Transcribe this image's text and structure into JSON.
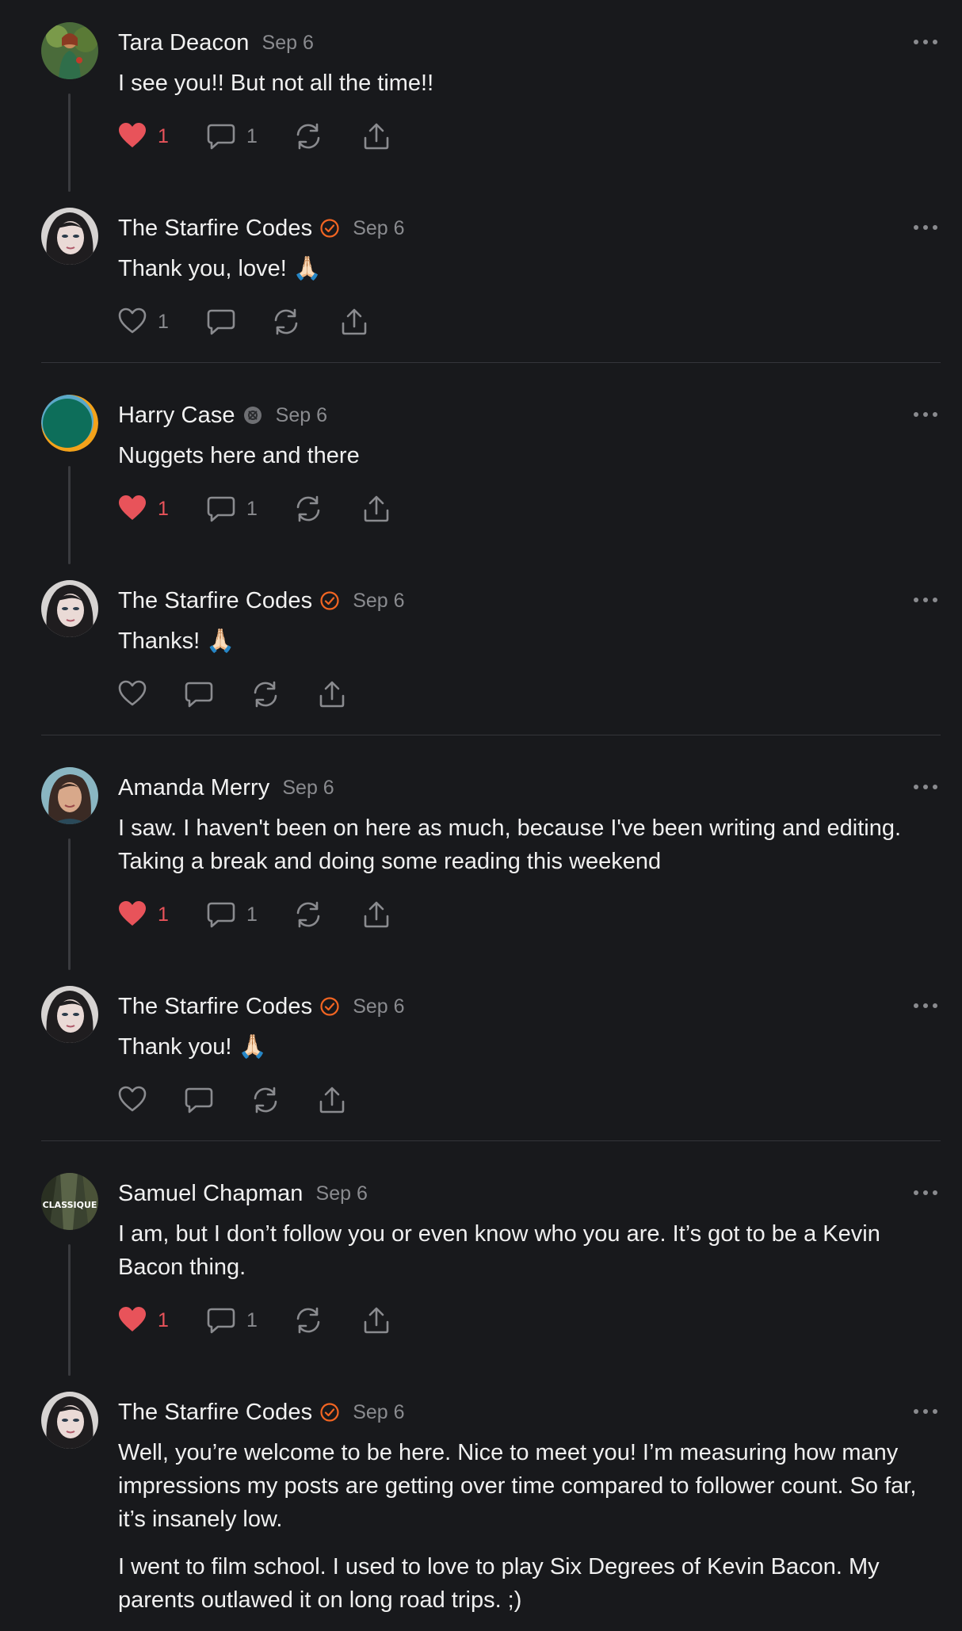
{
  "posts": [
    {
      "author": "Tara Deacon",
      "date": "Sep 6",
      "verified": false,
      "body": [
        "I see you!! But not all the time!!"
      ],
      "likes": "1",
      "replies": "1",
      "liked": true
    },
    {
      "author": "The Starfire Codes",
      "date": "Sep 6",
      "verified": true,
      "body": [
        "Thank you, love! 🙏🏻"
      ],
      "likes": "1",
      "replies": "",
      "liked": false
    },
    {
      "author": "Harry Case",
      "date": "Sep 6",
      "verified": false,
      "body": [
        "Nuggets here and there"
      ],
      "likes": "1",
      "replies": "1",
      "liked": true
    },
    {
      "author": "The Starfire Codes",
      "date": "Sep 6",
      "verified": true,
      "body": [
        "Thanks! 🙏🏻"
      ],
      "likes": "",
      "replies": "",
      "liked": false
    },
    {
      "author": "Amanda Merry",
      "date": "Sep 6",
      "verified": false,
      "body": [
        "I saw. I haven't been on here as much, because I've been writing and editing. Taking a break and doing some reading this weekend"
      ],
      "likes": "1",
      "replies": "1",
      "liked": true
    },
    {
      "author": "The Starfire Codes",
      "date": "Sep 6",
      "verified": true,
      "body": [
        "Thank you! 🙏🏻"
      ],
      "likes": "",
      "replies": "",
      "liked": false
    },
    {
      "author": "Samuel Chapman",
      "date": "Sep 6",
      "verified": false,
      "body": [
        "I am, but I don’t follow you or even know who you are. It’s got to be a Kevin Bacon thing."
      ],
      "likes": "1",
      "replies": "1",
      "liked": true
    },
    {
      "author": "The Starfire Codes",
      "date": "Sep 6",
      "verified": true,
      "body": [
        "Well, you’re welcome to be here. Nice to meet you! I’m measuring how many impressions my posts are getting over time compared to follower count. So far, it’s insanely low.",
        "I went to film school. I used to love to play Six Degrees of Kevin Bacon. My parents outlawed it on long road trips. ;)"
      ],
      "likes": "",
      "replies": "",
      "liked": false
    }
  ],
  "avatar_text": {
    "samuel": "CLASSIQUE"
  },
  "icons": {
    "like": "heart-icon",
    "reply": "comment-icon",
    "repost": "repost-icon",
    "share": "share-icon",
    "more": "more-horizontal-icon",
    "verified": "verified-check-icon",
    "harry_badge": "bordered-badge-icon"
  },
  "colors": {
    "background": "#18191c",
    "like_active": "#e8535a",
    "verified": "#f26522",
    "muted": "#8a8b8f",
    "divider": "#34353a",
    "thread_line": "#3a3b3f"
  }
}
